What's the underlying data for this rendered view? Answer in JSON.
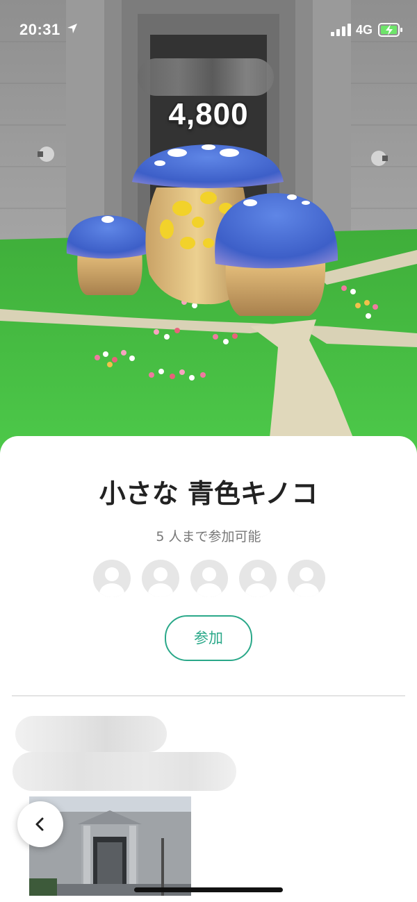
{
  "status_bar": {
    "time": "20:31",
    "network": "4G",
    "location_icon": "location-arrow-icon",
    "signal_icon": "signal-bars-icon",
    "battery_icon": "battery-charging-icon"
  },
  "scene": {
    "points": "4,800"
  },
  "sheet": {
    "title": "小さな 青色キノコ",
    "capacity": "5 人まで参加可能",
    "join_label": "参加",
    "participant_slots": 5,
    "accent_color": "#2aa889"
  },
  "navigation": {
    "back_icon": "chevron-left-icon"
  }
}
